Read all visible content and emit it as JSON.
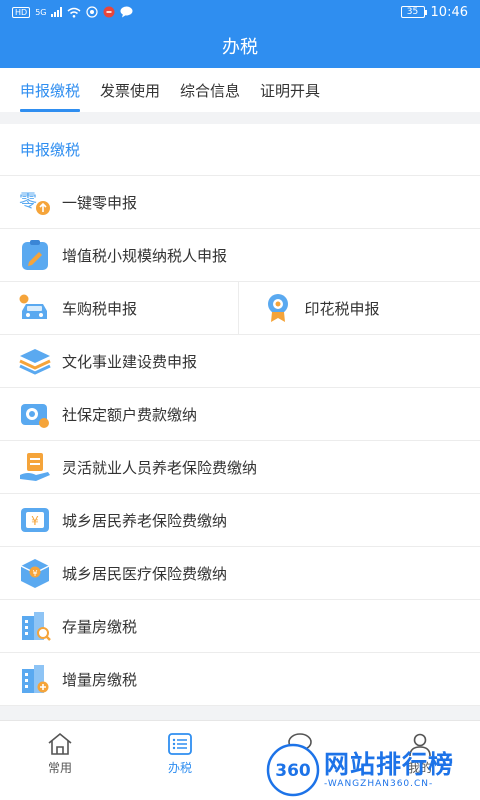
{
  "status_bar": {
    "time": "10:46",
    "battery": "35",
    "hd": "HD",
    "net": "5G"
  },
  "header": {
    "title": "办税"
  },
  "tabs": [
    {
      "label": "申报缴税",
      "active": true
    },
    {
      "label": "发票使用",
      "active": false
    },
    {
      "label": "综合信息",
      "active": false
    },
    {
      "label": "证明开具",
      "active": false
    }
  ],
  "section": {
    "title": "申报缴税"
  },
  "items": {
    "zero": "一键零申报",
    "vat": "增值税小规模纳税人申报",
    "vehicle": "车购税申报",
    "stamp": "印花税申报",
    "culture": "文化事业建设费申报",
    "social": "社保定额户费款缴纳",
    "flexible": "灵活就业人员养老保险费缴纳",
    "pension": "城乡居民养老保险费缴纳",
    "medical": "城乡居民医疗保险费缴纳",
    "stock_house": "存量房缴税",
    "new_house": "增量房缴税"
  },
  "zero_icon_char": "零",
  "yuan_char": "¥",
  "bottom_nav": [
    {
      "label": "常用",
      "active": false
    },
    {
      "label": "办税",
      "active": true
    },
    {
      "label": "",
      "active": false
    },
    {
      "label": "我的",
      "active": false
    }
  ],
  "watermark": {
    "cn": "网站排行榜",
    "en": "-WANGZHAN360.CN-",
    "badge": "360"
  },
  "colors": {
    "primary": "#2f8ef0",
    "orange": "#f5a43a",
    "icon_blue": "#5aa9f0"
  }
}
